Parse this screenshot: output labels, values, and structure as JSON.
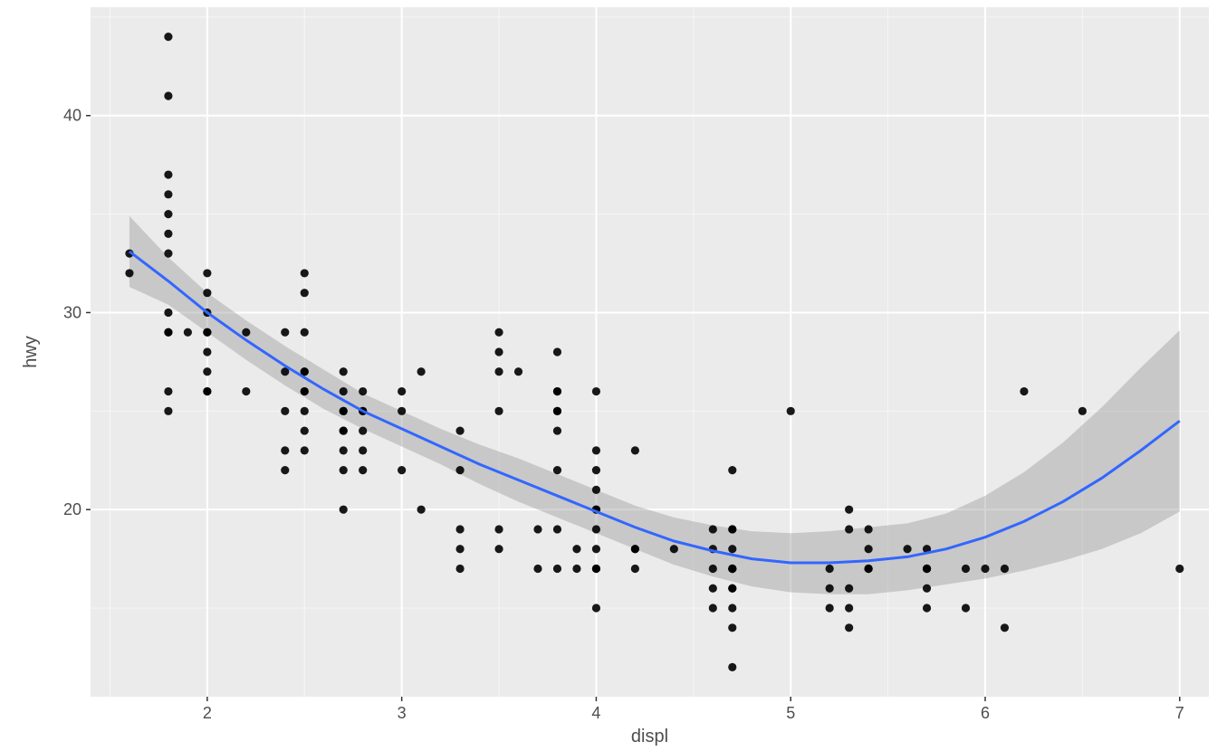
{
  "chart_data": {
    "type": "scatter",
    "title": "",
    "xlabel": "displ",
    "ylabel": "hwy",
    "xlim": [
      1.4,
      7.15
    ],
    "ylim": [
      10.5,
      45.5
    ],
    "x_ticks": [
      2,
      3,
      4,
      5,
      6,
      7
    ],
    "y_ticks": [
      20,
      30,
      40
    ],
    "x_minor": [
      1.5,
      2.5,
      3.5,
      4.5,
      5.5,
      6.5
    ],
    "y_minor": [
      15,
      25,
      35,
      45
    ],
    "series": [
      {
        "name": "points",
        "type": "scatter",
        "x": [
          1.6,
          1.6,
          1.8,
          1.8,
          1.8,
          1.8,
          1.8,
          1.8,
          1.8,
          1.8,
          1.8,
          1.8,
          1.8,
          1.8,
          1.9,
          2.0,
          2.0,
          2.0,
          2.0,
          2.0,
          2.0,
          2.0,
          2.0,
          2.0,
          2.2,
          2.2,
          2.4,
          2.4,
          2.4,
          2.4,
          2.4,
          2.5,
          2.5,
          2.5,
          2.5,
          2.5,
          2.5,
          2.5,
          2.5,
          2.5,
          2.5,
          2.7,
          2.7,
          2.7,
          2.7,
          2.7,
          2.7,
          2.7,
          2.7,
          2.7,
          2.8,
          2.8,
          2.8,
          2.8,
          2.8,
          2.8,
          3.0,
          3.0,
          3.0,
          3.1,
          3.1,
          3.3,
          3.3,
          3.3,
          3.3,
          3.3,
          3.5,
          3.5,
          3.5,
          3.5,
          3.5,
          3.5,
          3.6,
          3.7,
          3.7,
          3.8,
          3.8,
          3.8,
          3.8,
          3.8,
          3.8,
          3.8,
          3.8,
          3.8,
          3.9,
          3.9,
          4.0,
          4.0,
          4.0,
          4.0,
          4.0,
          4.0,
          4.0,
          4.0,
          4.0,
          4.0,
          4.0,
          4.2,
          4.2,
          4.2,
          4.2,
          4.4,
          4.6,
          4.6,
          4.6,
          4.6,
          4.6,
          4.7,
          4.7,
          4.7,
          4.7,
          4.7,
          4.7,
          4.7,
          4.7,
          4.7,
          4.7,
          4.7,
          4.7,
          4.7,
          5.0,
          5.2,
          5.2,
          5.2,
          5.3,
          5.3,
          5.3,
          5.3,
          5.3,
          5.4,
          5.4,
          5.4,
          5.4,
          5.4,
          5.6,
          5.7,
          5.7,
          5.7,
          5.7,
          5.7,
          5.7,
          5.9,
          5.9,
          6.0,
          6.1,
          6.1,
          6.2,
          6.5,
          7.0
        ],
        "y": [
          33,
          32,
          36,
          29,
          25,
          26,
          35,
          37,
          30,
          33,
          44,
          41,
          29,
          34,
          29,
          26,
          31,
          29,
          30,
          28,
          32,
          29,
          26,
          27,
          26,
          29,
          29,
          25,
          27,
          22,
          23,
          25,
          32,
          31,
          27,
          26,
          24,
          29,
          27,
          26,
          23,
          20,
          24,
          25,
          23,
          27,
          26,
          25,
          24,
          22,
          24,
          22,
          25,
          25,
          23,
          26,
          22,
          25,
          26,
          27,
          20,
          17,
          19,
          22,
          18,
          24,
          29,
          25,
          18,
          27,
          19,
          28,
          27,
          17,
          19,
          28,
          25,
          24,
          22,
          26,
          19,
          25,
          17,
          26,
          17,
          18,
          17,
          18,
          15,
          17,
          22,
          21,
          20,
          26,
          23,
          19,
          20,
          17,
          18,
          18,
          23,
          18,
          15,
          16,
          17,
          18,
          19,
          12,
          16,
          17,
          14,
          18,
          19,
          17,
          22,
          17,
          19,
          15,
          16,
          17,
          25,
          17,
          16,
          15,
          19,
          16,
          15,
          20,
          14,
          18,
          17,
          17,
          17,
          19,
          18,
          17,
          15,
          17,
          17,
          16,
          18,
          17,
          15,
          17,
          17,
          14,
          26,
          25,
          17,
          24
        ]
      },
      {
        "name": "smooth",
        "type": "line",
        "x": [
          1.6,
          1.8,
          2.0,
          2.2,
          2.4,
          2.6,
          2.8,
          3.0,
          3.2,
          3.4,
          3.6,
          3.8,
          4.0,
          4.2,
          4.4,
          4.6,
          4.8,
          5.0,
          5.2,
          5.4,
          5.6,
          5.8,
          6.0,
          6.2,
          6.4,
          6.6,
          6.8,
          7.0
        ],
        "y": [
          33.1,
          31.6,
          30.0,
          28.6,
          27.3,
          26.1,
          25.0,
          24.1,
          23.2,
          22.3,
          21.5,
          20.7,
          19.9,
          19.1,
          18.4,
          17.9,
          17.5,
          17.3,
          17.3,
          17.4,
          17.6,
          18.0,
          18.6,
          19.4,
          20.4,
          21.6,
          23.0,
          24.5
        ],
        "ci_lo": [
          31.3,
          30.4,
          29.0,
          27.6,
          26.3,
          25.1,
          24.1,
          23.2,
          22.3,
          21.3,
          20.4,
          19.6,
          18.8,
          18.0,
          17.2,
          16.6,
          16.1,
          15.8,
          15.7,
          15.7,
          15.9,
          16.2,
          16.5,
          16.9,
          17.4,
          18.0,
          18.8,
          19.9
        ],
        "ci_hi": [
          34.9,
          32.8,
          31.0,
          29.6,
          28.3,
          27.1,
          25.9,
          25.0,
          24.1,
          23.3,
          22.6,
          21.8,
          21.0,
          20.2,
          19.6,
          19.2,
          18.9,
          18.8,
          18.9,
          19.1,
          19.3,
          19.8,
          20.7,
          21.9,
          23.4,
          25.2,
          27.2,
          29.1
        ]
      }
    ]
  },
  "axes": {
    "x": "displ",
    "y": "hwy"
  },
  "x_ticks": [
    "2",
    "3",
    "4",
    "5",
    "6",
    "7"
  ],
  "y_ticks": [
    "20",
    "30",
    "40"
  ]
}
